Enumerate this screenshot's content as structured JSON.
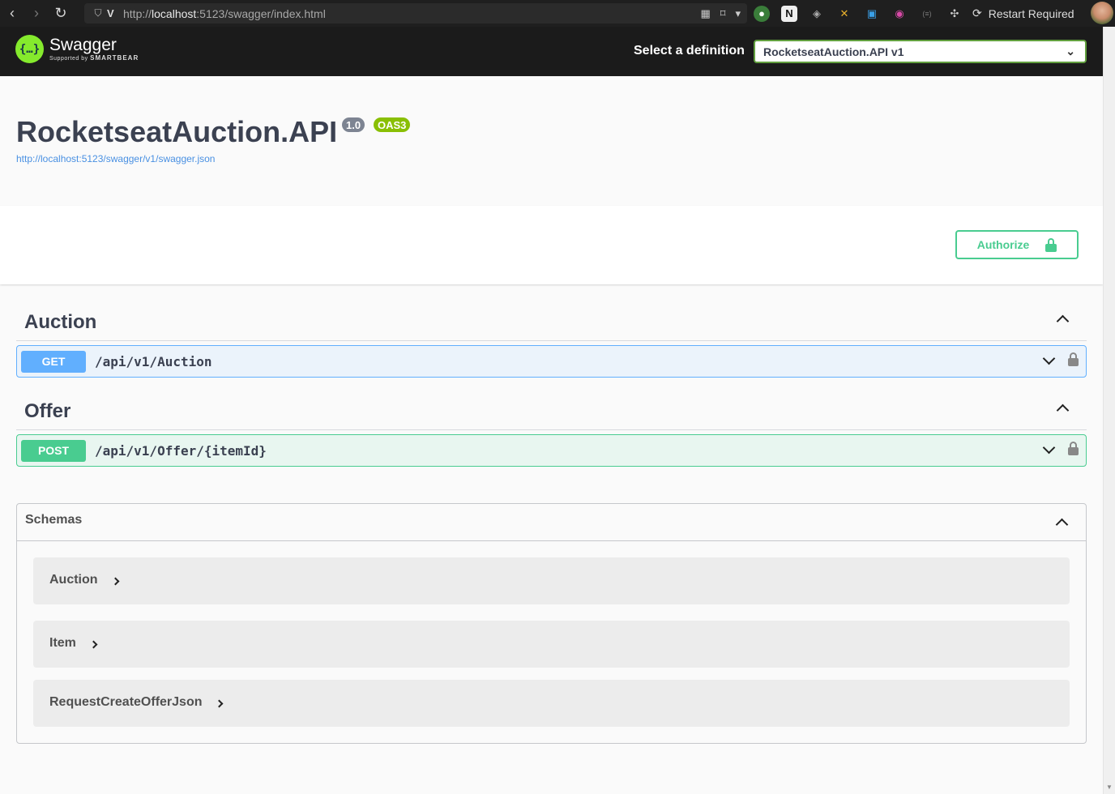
{
  "browser": {
    "url_prefix": "http://",
    "url_host": "localhost",
    "url_rest": ":5123/swagger/index.html",
    "restart_label": "Restart Required"
  },
  "topbar": {
    "logo_text": "Swagger",
    "logo_sub": "Supported by",
    "logo_brand": "SMARTBEAR",
    "definition_label": "Select a definition",
    "definition_value": "RocketseatAuction.API v1"
  },
  "info": {
    "title": "RocketseatAuction.API",
    "version": "1.0",
    "oas": "OAS3",
    "spec_url": "http://localhost:5123/swagger/v1/swagger.json"
  },
  "scheme": {
    "authorize_label": "Authorize"
  },
  "tags": [
    {
      "name": "Auction",
      "operations": [
        {
          "method": "GET",
          "path": "/api/v1/Auction"
        }
      ]
    },
    {
      "name": "Offer",
      "operations": [
        {
          "method": "POST",
          "path": "/api/v1/Offer/{itemId}"
        }
      ]
    }
  ],
  "schemas": {
    "title": "Schemas",
    "items": [
      "Auction",
      "Item",
      "RequestCreateOfferJson"
    ]
  },
  "colors": {
    "get": "#61affe",
    "post": "#49cc90",
    "topbar": "#1b1b1b",
    "swagger_green": "#85ea2d"
  }
}
